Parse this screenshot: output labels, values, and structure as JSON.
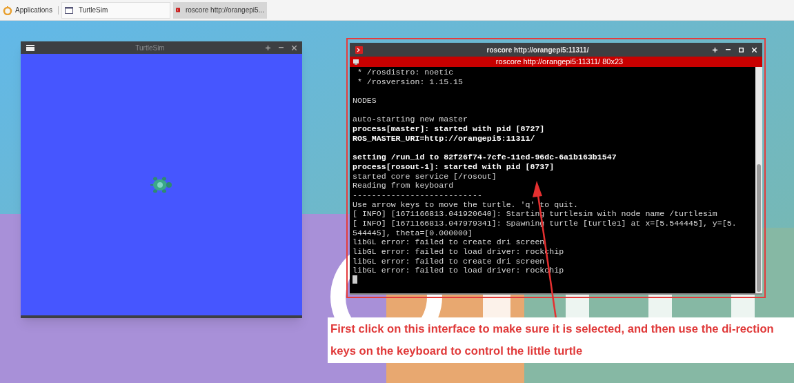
{
  "taskbar": {
    "menu_label": "Applications",
    "tasks": [
      {
        "title": "TurtleSim",
        "kind": "window",
        "selected": false
      },
      {
        "title": "roscore http://orangepi5...",
        "kind": "terminal",
        "selected": true
      }
    ]
  },
  "turtlesim_window": {
    "title": "TurtleSim"
  },
  "terminal_window": {
    "title": "roscore http://orangepi5:11311/",
    "tab_title": "roscore http://orangepi5:11311/ 80x23",
    "lines": [
      {
        "kind": "text",
        "text": " * /rosdistro: noetic",
        "bold": false
      },
      {
        "kind": "text",
        "text": " * /rosversion: 1.15.15",
        "bold": false
      },
      {
        "kind": "blank"
      },
      {
        "kind": "text",
        "text": "NODES",
        "bold": false
      },
      {
        "kind": "blank"
      },
      {
        "kind": "text",
        "text": "auto-starting new master",
        "bold": false
      },
      {
        "kind": "text",
        "text": "process[master]: started with pid [8727]",
        "bold": true
      },
      {
        "kind": "text",
        "text": "ROS_MASTER_URI=http://orangepi5:11311/",
        "bold": true
      },
      {
        "kind": "blank"
      },
      {
        "kind": "text",
        "text": "setting /run_id to 82f26f74-7cfe-11ed-96dc-6a1b163b1547",
        "bold": true
      },
      {
        "kind": "text",
        "text": "process[rosout-1]: started with pid [8737]",
        "bold": true
      },
      {
        "kind": "text",
        "text": "started core service [/rosout]",
        "bold": false
      },
      {
        "kind": "text",
        "text": "Reading from keyboard",
        "bold": false
      },
      {
        "kind": "text",
        "text": "---------------------------",
        "bold": false
      },
      {
        "kind": "text",
        "text": "Use arrow keys to move the turtle. 'q' to quit.",
        "bold": false
      },
      {
        "kind": "text",
        "text": "[ INFO] [1671166813.041920640]: Starting turtlesim with node name /turtlesim",
        "bold": false
      },
      {
        "kind": "text",
        "text": "[ INFO] [1671166813.047979341]: Spawning turtle [turtle1] at x=[5.544445], y=[5.",
        "bold": false
      },
      {
        "kind": "text",
        "text": "544445], theta=[0.000000]",
        "bold": false
      },
      {
        "kind": "text",
        "text": "libGL error: failed to create dri screen",
        "bold": false
      },
      {
        "kind": "text",
        "text": "libGL error: failed to load driver: rockchip",
        "bold": false
      },
      {
        "kind": "text",
        "text": "libGL error: failed to create dri screen",
        "bold": false
      },
      {
        "kind": "text",
        "text": "libGL error: failed to load driver: rockchip",
        "bold": false
      },
      {
        "kind": "cursor"
      }
    ]
  },
  "annotation": {
    "text": "First click on this interface to make sure it is selected, and then use the di-rection keys on the keyboard to control the little turtle"
  }
}
